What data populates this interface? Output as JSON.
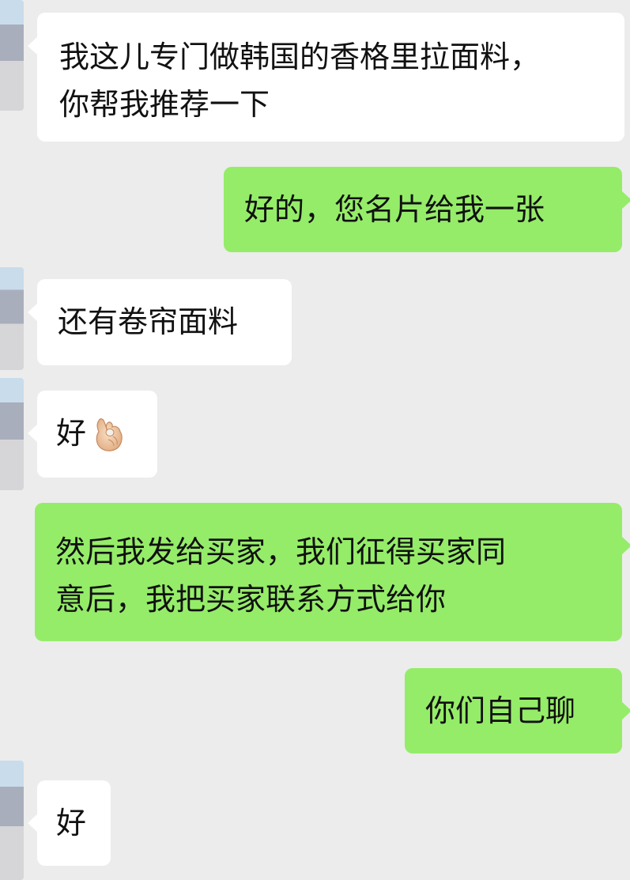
{
  "chat": {
    "messages": [
      {
        "side": "left",
        "lines": [
          "我这儿专门做韩国的香格里拉面料，",
          "你帮我推荐一下"
        ]
      },
      {
        "side": "right",
        "lines": [
          "好的，您名片给我一张"
        ]
      },
      {
        "side": "left",
        "lines": [
          "还有卷帘面料"
        ]
      },
      {
        "side": "left",
        "lines": [
          "好"
        ],
        "emoji": "ok-hand-icon"
      },
      {
        "side": "right",
        "lines": [
          "然后我发给买家，我们征得买家同",
          "意后，我把买家联系方式给你"
        ]
      },
      {
        "side": "right",
        "lines": [
          "你们自己聊"
        ]
      },
      {
        "side": "left",
        "lines": [
          "好"
        ]
      }
    ]
  },
  "colors": {
    "background": "#ececec",
    "incoming_bubble": "#ffffff",
    "outgoing_bubble": "#95ec69",
    "text": "#111111"
  }
}
